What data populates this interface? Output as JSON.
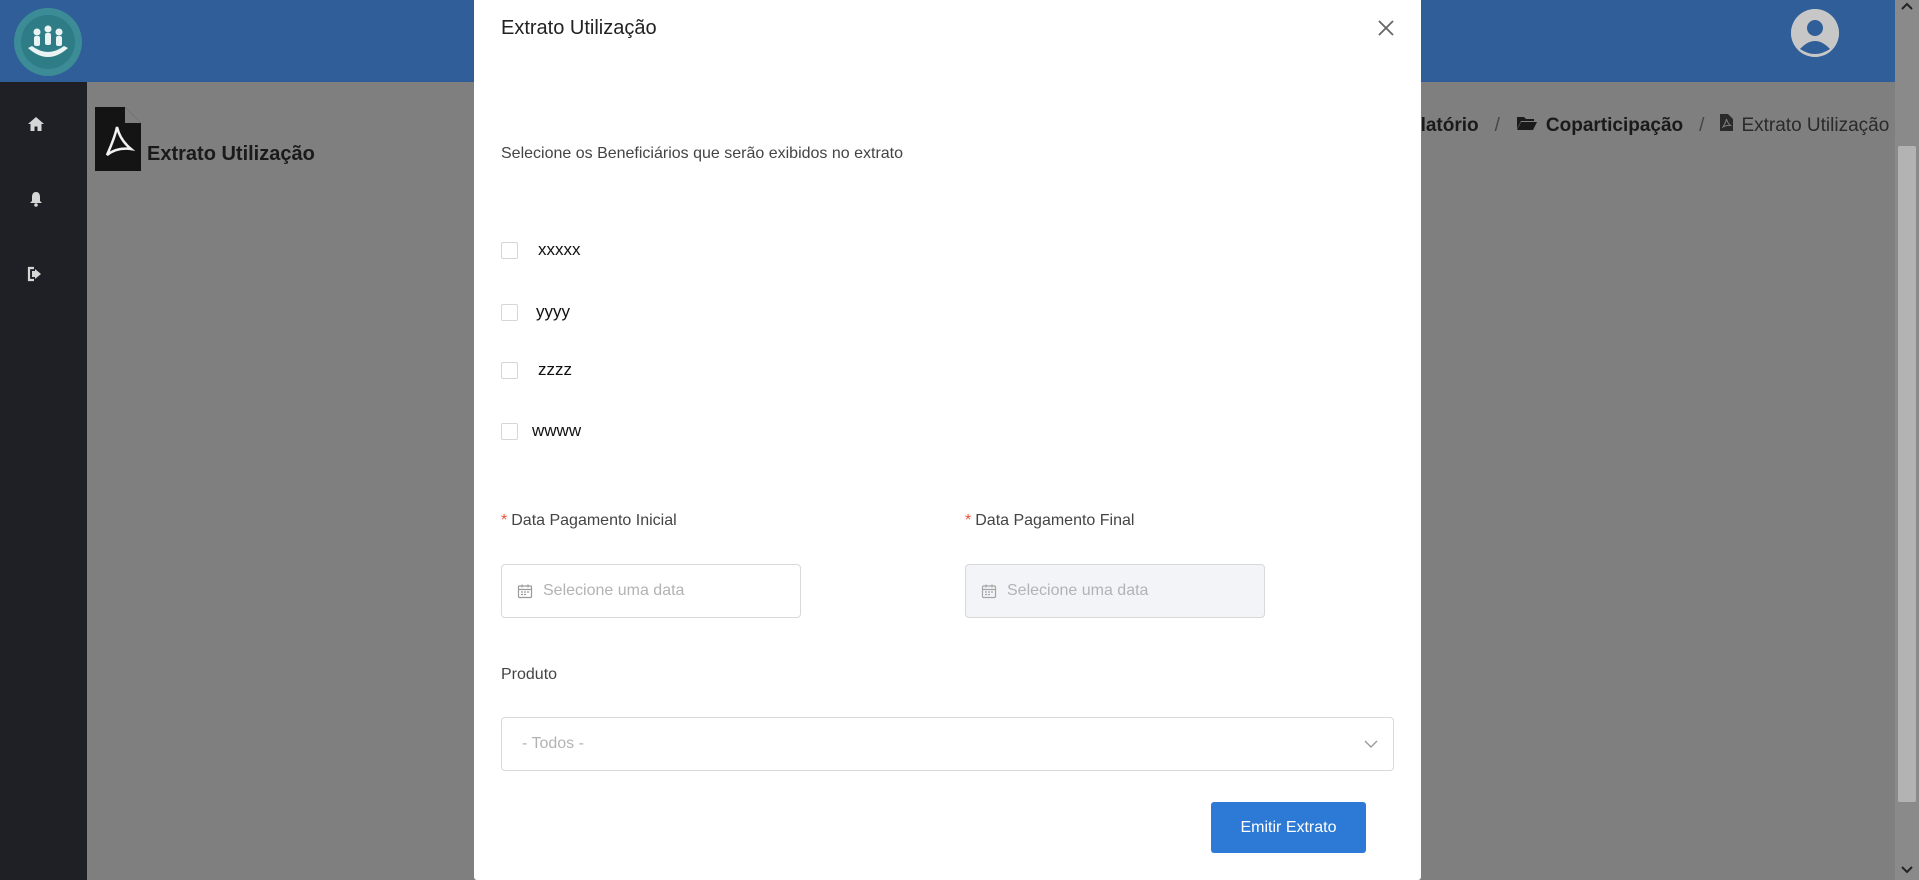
{
  "app": {
    "page_title": "Extrato Utilização",
    "breadcrumb": {
      "item1": "elatório",
      "item2": "Coparticipação",
      "item3": "Extrato Utilização"
    }
  },
  "modal": {
    "title": "Extrato Utilização",
    "instructions": "Selecione os Beneficiários que serão exibidos no extrato",
    "beneficiaries": [
      {
        "label": "xxxxx",
        "checked": false
      },
      {
        "label": "yyyy",
        "checked": false
      },
      {
        "label": "zzzz",
        "checked": false
      },
      {
        "label": "wwww",
        "checked": false
      }
    ],
    "date_start": {
      "label": "Data Pagamento Inicial",
      "required_mark": "*",
      "placeholder": "Selecione uma data"
    },
    "date_end": {
      "label": "Data Pagamento Final",
      "required_mark": "*",
      "placeholder": "Selecione uma data",
      "disabled": true
    },
    "product": {
      "label": "Produto",
      "selected": "- Todos -"
    },
    "submit_label": "Emitir Extrato"
  },
  "colors": {
    "topbar": "#2f5e98",
    "sidebar": "#1f2026",
    "primary_button": "#2d7ad6",
    "required": "#e5533d"
  },
  "icons": [
    "logo-icon",
    "avatar-icon",
    "home-icon",
    "bell-icon",
    "logout-icon",
    "file-pdf-icon",
    "folder-open-icon",
    "close-icon",
    "calendar-icon",
    "chevron-down-icon"
  ]
}
